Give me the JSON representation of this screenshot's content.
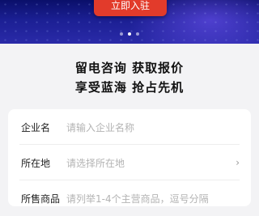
{
  "banner": {
    "cta_label": "立即入驻",
    "carousel": {
      "count": 3,
      "active": 1
    }
  },
  "headline": {
    "line1": "留电咨询  获取报价",
    "line2": "享受蓝海  抢占先机"
  },
  "form": {
    "company": {
      "label": "企业名",
      "placeholder": "请输入企业名称"
    },
    "location": {
      "label": "所在地",
      "placeholder": "请选择所在地"
    },
    "products": {
      "label": "所售商品",
      "placeholder": "请列举1-4个主营商品，逗号分隔"
    }
  },
  "icons": {
    "chevron": "chevron-right-icon"
  },
  "colors": {
    "accent": "#e23b2b",
    "banner": "#1b1f93"
  }
}
